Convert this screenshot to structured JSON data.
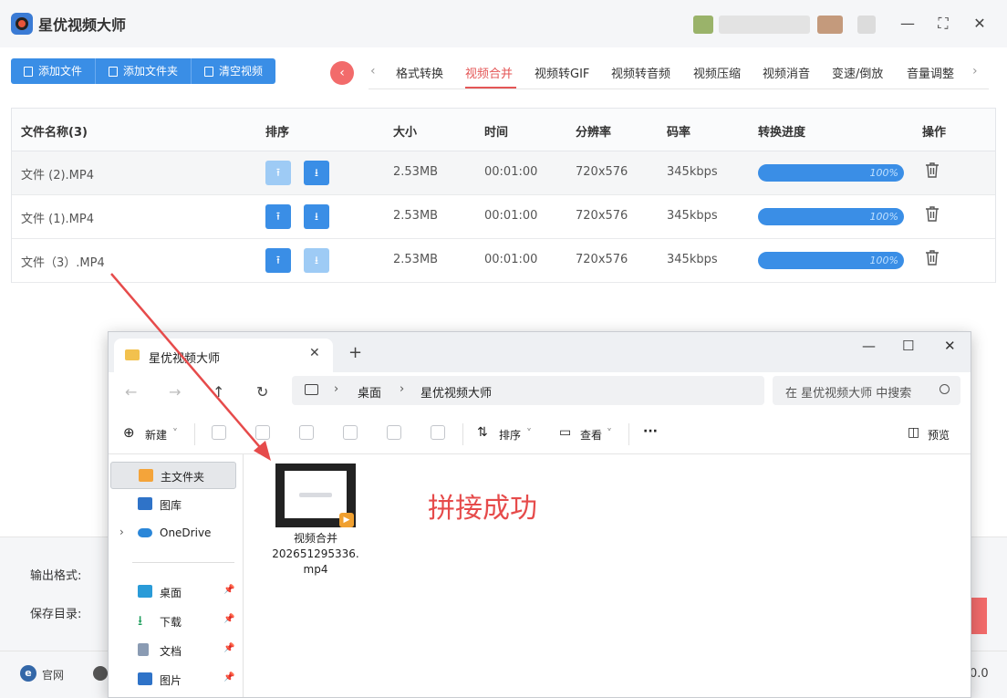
{
  "app": {
    "title": "星优视频大师",
    "version_fragment": "0.0"
  },
  "toolbar": {
    "add_file": "添加文件",
    "add_folder": "添加文件夹",
    "clear_video": "清空视频"
  },
  "tabs": [
    {
      "label": "格式转换",
      "active": false
    },
    {
      "label": "视频合并",
      "active": true
    },
    {
      "label": "视频转GIF",
      "active": false
    },
    {
      "label": "视频转音频",
      "active": false
    },
    {
      "label": "视频压缩",
      "active": false
    },
    {
      "label": "视频消音",
      "active": false
    },
    {
      "label": "变速/倒放",
      "active": false
    },
    {
      "label": "音量调整",
      "active": false
    }
  ],
  "table": {
    "headers": {
      "name": "文件名称(3)",
      "sort": "排序",
      "size": "大小",
      "time": "时间",
      "resolution": "分辨率",
      "bitrate": "码率",
      "progress": "转换进度",
      "action": "操作"
    },
    "rows": [
      {
        "name": "文件 (2).MP4",
        "size": "2.53MB",
        "time": "00:01:00",
        "resolution": "720x576",
        "bitrate": "345kbps",
        "progress": "100%",
        "progress_value": 1.0
      },
      {
        "name": "文件 (1).MP4",
        "size": "2.53MB",
        "time": "00:01:00",
        "resolution": "720x576",
        "bitrate": "345kbps",
        "progress": "100%",
        "progress_value": 1.0
      },
      {
        "name": "文件（3）.MP4",
        "size": "2.53MB",
        "time": "00:01:00",
        "resolution": "720x576",
        "bitrate": "345kbps",
        "progress": "100%",
        "progress_value": 1.0
      }
    ]
  },
  "bottom": {
    "output_format_label": "输出格式:",
    "save_dir_label": "保存目录:",
    "footer_site": "官网"
  },
  "explorer": {
    "tab_title": "星优视频大师",
    "breadcrumb": [
      "桌面",
      "星优视频大师"
    ],
    "search_placeholder": "在 星优视频大师 中搜索",
    "cmd_new": "新建",
    "cmd_sort": "排序",
    "cmd_view": "查看",
    "cmd_more": "···",
    "cmd_preview": "预览",
    "sidebar": [
      {
        "label": "主文件夹",
        "icon": "home-icon"
      },
      {
        "label": "图库",
        "icon": "gallery-icon"
      },
      {
        "label": "OneDrive",
        "icon": "cloud-icon"
      },
      {
        "label": "桌面",
        "icon": "desktop-icon"
      },
      {
        "label": "下载",
        "icon": "download-icon"
      },
      {
        "label": "文档",
        "icon": "document-icon"
      },
      {
        "label": "图片",
        "icon": "picture-icon"
      }
    ],
    "file": {
      "name_line1": "视频合并",
      "name_line2": "202651295336.",
      "name_line3": "mp4"
    }
  },
  "annotation": {
    "success_text": "拼接成功",
    "color": "#e64b4b"
  },
  "colors": {
    "primary": "#3a8ee6",
    "accent": "#e45656"
  }
}
